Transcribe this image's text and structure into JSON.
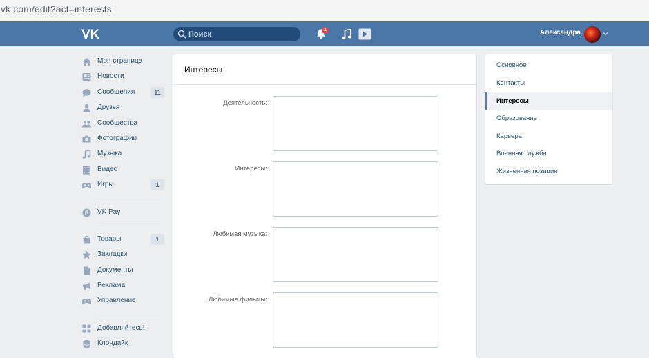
{
  "browser": {
    "url": "vk.com/edit?act=interests"
  },
  "header": {
    "search_placeholder": "Поиск",
    "notifications_count": "1",
    "user_name": "Александра"
  },
  "leftnav": {
    "items": [
      {
        "label": "Моя страница",
        "icon": "home-icon"
      },
      {
        "label": "Новости",
        "icon": "news-icon"
      },
      {
        "label": "Сообщения",
        "icon": "messages-icon",
        "count": "11"
      },
      {
        "label": "Друзья",
        "icon": "friends-icon"
      },
      {
        "label": "Сообщества",
        "icon": "groups-icon"
      },
      {
        "label": "Фотографии",
        "icon": "camera-icon"
      },
      {
        "label": "Музыка",
        "icon": "music-note-icon"
      },
      {
        "label": "Видео",
        "icon": "film-icon"
      },
      {
        "label": "Игры",
        "icon": "gamepad-icon",
        "count": "1"
      }
    ],
    "pay": {
      "label": "VK Pay",
      "icon": "vkpay-icon"
    },
    "items2": [
      {
        "label": "Товары",
        "icon": "bag-icon",
        "count": "1"
      },
      {
        "label": "Закладки",
        "icon": "star-icon"
      },
      {
        "label": "Документы",
        "icon": "document-icon"
      },
      {
        "label": "Реклама",
        "icon": "megaphone-icon"
      },
      {
        "label": "Управление",
        "icon": "gamepad-icon"
      }
    ],
    "items3": [
      {
        "label": "Добавляйтесь!",
        "icon": "apps-icon"
      },
      {
        "label": "Клондайк",
        "icon": "coins-icon"
      }
    ]
  },
  "main": {
    "title": "Интересы",
    "fields": [
      {
        "label": "Деятельность:",
        "value": ""
      },
      {
        "label": "Интересы:",
        "value": ""
      },
      {
        "label": "Любимая музыка:",
        "value": ""
      },
      {
        "label": "Любимые фильмы:",
        "value": ""
      }
    ]
  },
  "rightmenu": {
    "items": [
      {
        "label": "Основное"
      },
      {
        "label": "Контакты"
      },
      {
        "label": "Интересы",
        "active": true
      },
      {
        "label": "Образование"
      },
      {
        "label": "Карьера"
      },
      {
        "label": "Военная служба"
      },
      {
        "label": "Жизненная позиция"
      }
    ]
  },
  "colors": {
    "header": "#4a76a8",
    "link": "#285473",
    "background": "#edeef0",
    "active_marker": "#5181b8"
  }
}
